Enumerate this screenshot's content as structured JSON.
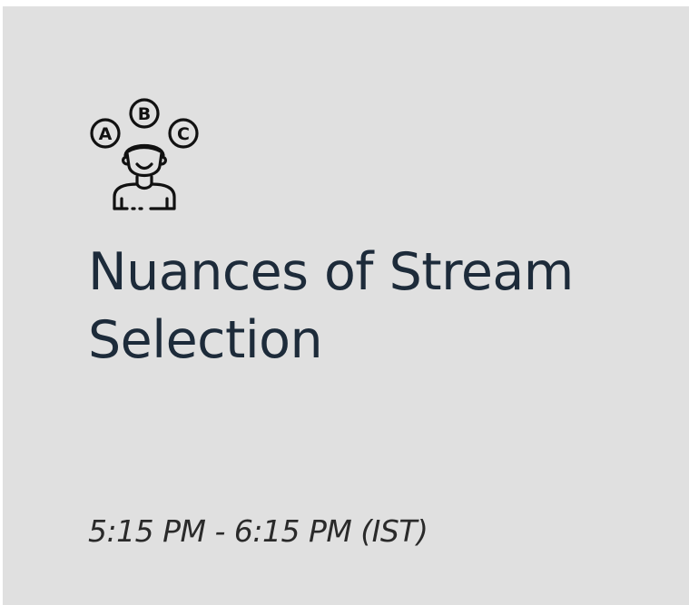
{
  "card": {
    "icon": "person-choosing-options-abc-icon",
    "icon_letters": [
      "A",
      "B",
      "C"
    ],
    "title": "Nuances of Stream Selection",
    "time": "5:15 PM - 6:15 PM (IST)"
  },
  "colors": {
    "card_background": "#e0e0e0",
    "title_text": "#1d2b3a",
    "time_text": "#2a2a2a",
    "icon_stroke": "#111111"
  }
}
